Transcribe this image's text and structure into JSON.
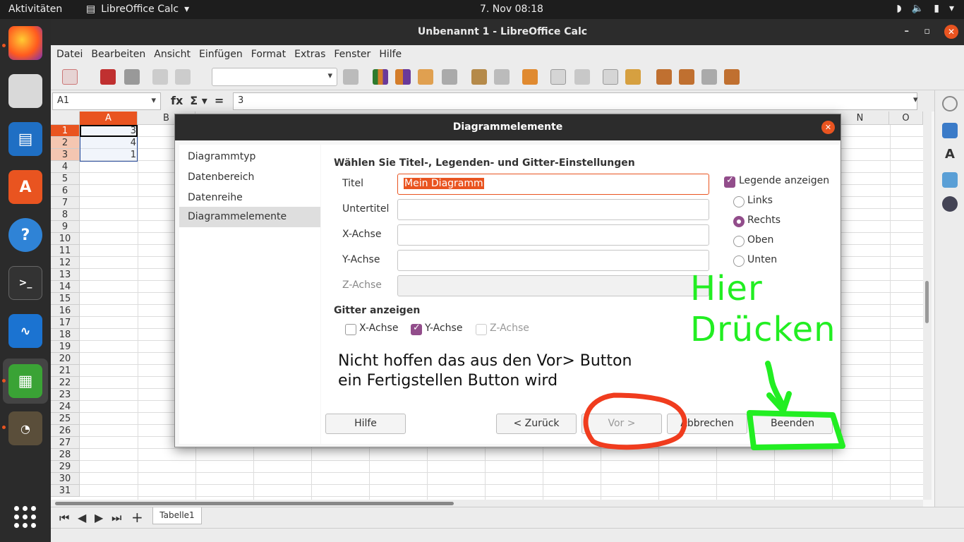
{
  "topbar": {
    "activities": "Aktivitäten",
    "app_name": "LibreOffice Calc",
    "clock": "7. Nov  08:18"
  },
  "window": {
    "title": "Unbenannt 1 - LibreOffice Calc"
  },
  "menu": [
    "Datei",
    "Bearbeiten",
    "Ansicht",
    "Einfügen",
    "Format",
    "Extras",
    "Fenster",
    "Hilfe"
  ],
  "formula_bar": {
    "name_box": "A1",
    "formula": "3"
  },
  "sheet": {
    "columns": [
      "A",
      "B",
      "N",
      "O"
    ],
    "rows": [
      "1",
      "2",
      "3",
      "4",
      "5",
      "6",
      "7",
      "8",
      "9",
      "10",
      "11",
      "12",
      "13",
      "14",
      "15",
      "16",
      "17",
      "18",
      "19",
      "20",
      "21",
      "22",
      "23",
      "24",
      "25",
      "26",
      "27",
      "28",
      "29",
      "30",
      "31"
    ],
    "cells": {
      "A1": "3",
      "A2": "4",
      "A3": "1"
    }
  },
  "sheet_tabs": {
    "active": "Tabelle1"
  },
  "dialog": {
    "title": "Diagrammelemente",
    "steps": [
      "Diagrammtyp",
      "Datenbereich",
      "Datenreihe",
      "Diagrammelemente"
    ],
    "active_step": "Diagrammelemente",
    "heading": "Wählen Sie Titel-, Legenden- und Gitter-Einstellungen",
    "fields": {
      "titel_label": "Titel",
      "titel_value": "Mein Diagramm",
      "untertitel_label": "Untertitel",
      "xachse_label": "X-Achse",
      "yachse_label": "Y-Achse",
      "zachse_label": "Z-Achse"
    },
    "legend": {
      "show_label": "Legende anzeigen",
      "show_checked": true,
      "positions": [
        "Links",
        "Rechts",
        "Oben",
        "Unten"
      ],
      "selected": "Rechts"
    },
    "grid": {
      "heading": "Gitter anzeigen",
      "x_label": "X-Achse",
      "y_label": "Y-Achse",
      "z_label": "Z-Achse",
      "y_checked": true
    },
    "buttons": {
      "help": "Hilfe",
      "back": "< Zurück",
      "next": "Vor >",
      "cancel": "Abbrechen",
      "finish": "Beenden"
    }
  },
  "annotations": {
    "green_line1": "Hier",
    "green_line2": "Drücken",
    "black_line1": "Nicht hoffen das aus den Vor> Button",
    "black_line2": "ein Fertigstellen Button wird",
    "green_color": "#22ee22",
    "red_color": "#f03c1e"
  },
  "colors": {
    "accent": "#e95420",
    "check": "#924d8b"
  }
}
